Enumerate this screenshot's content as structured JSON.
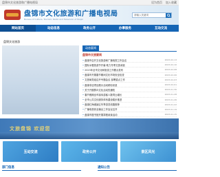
{
  "topbar": {
    "left_text": "盘锦市文化旅游和广播电视局",
    "links": [
      "设为首页",
      "加入收藏"
    ]
  },
  "header": {
    "title": "盘锦市文化旅游和广播电视局",
    "subtitle": "Bureau of Culture, Tourism, Radio and Television of Panjin",
    "search_placeholder": "请输入关键词"
  },
  "nav": {
    "items": [
      {
        "label": "网站首页",
        "active": true
      },
      {
        "label": "动态信息",
        "active": false
      },
      {
        "label": "政务公开",
        "active": false
      },
      {
        "label": "办事服务",
        "active": false
      },
      {
        "label": "互动交流",
        "active": false
      }
    ]
  },
  "left_panel": {
    "caption": "盘锦文化旅游"
  },
  "right_panel": {
    "tab": "动态要闻",
    "sub_title": "盘锦市文旅要闻",
    "news": [
      {
        "title": "盘锦市召开文化旅游和广播电视工作会议",
        "date": "2023-02-13"
      },
      {
        "title": "国际冰雪旅游节开幕 助力冬季文旅消费",
        "date": "2023-02-10"
      },
      {
        "title": "2023年全市文化和旅游工作要点发布",
        "date": "2023-02-08"
      },
      {
        "title": "盘锦市开展春节期间文化市场安全检查",
        "date": "2023-02-06"
      },
      {
        "title": "文旅局党组召开专题会议 部署重点工作",
        "date": "2023-02-03"
      },
      {
        "title": "盘锦非遗项目展示活动精彩纷呈",
        "date": "2023-02-01"
      },
      {
        "title": "关于开展群众文化活动的通知",
        "date": "2023-01-30"
      },
      {
        "title": "春节假期全市接待游客人数同比增长",
        "date": "2023-01-28"
      },
      {
        "title": "全市公共文化服务体系建设稳步推进",
        "date": "2023-01-26"
      },
      {
        "title": "盘锦红海滩景区冬季游览线路推荐",
        "date": "2023-01-22"
      },
      {
        "title": "广播电视安全播出工作会议召开",
        "date": "2023-01-19"
      },
      {
        "title": "盘锦市图书馆开展寒假阅读活动",
        "date": "2023-01-15"
      }
    ]
  },
  "banner": {
    "caption": "文旅盘锦 欢迎您"
  },
  "blocks": [
    {
      "label": "互动交流"
    },
    {
      "label": "政务公开"
    },
    {
      "label": "景区风光"
    }
  ],
  "bottom": [
    {
      "label": "部门信息"
    },
    {
      "label": "通知公告"
    }
  ],
  "colors": {
    "brand": "#1565b5",
    "accent_red": "#c0392b"
  }
}
